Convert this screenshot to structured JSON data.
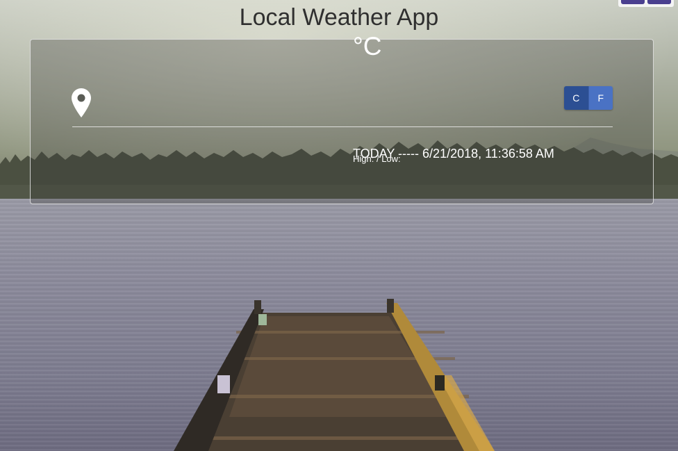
{
  "app": {
    "title": "Local Weather App"
  },
  "weather": {
    "temperature": "",
    "unit_symbol": "°C",
    "location": "",
    "today_label": "TODAY",
    "separator": "-----",
    "datetime": "6/21/2018, 11:36:58 AM",
    "high_label": "High: ",
    "low_label": "/ Low: "
  },
  "unit_toggle": {
    "celsius_label": "C",
    "fahrenheit_label": "F",
    "active": "C"
  },
  "icons": {
    "location": "map-marker-icon"
  },
  "colors": {
    "celsius_button": "#2c4f93",
    "fahrenheit_button": "#4a72c4",
    "title_text": "#2f2f2f",
    "card_text": "#ffffff"
  }
}
